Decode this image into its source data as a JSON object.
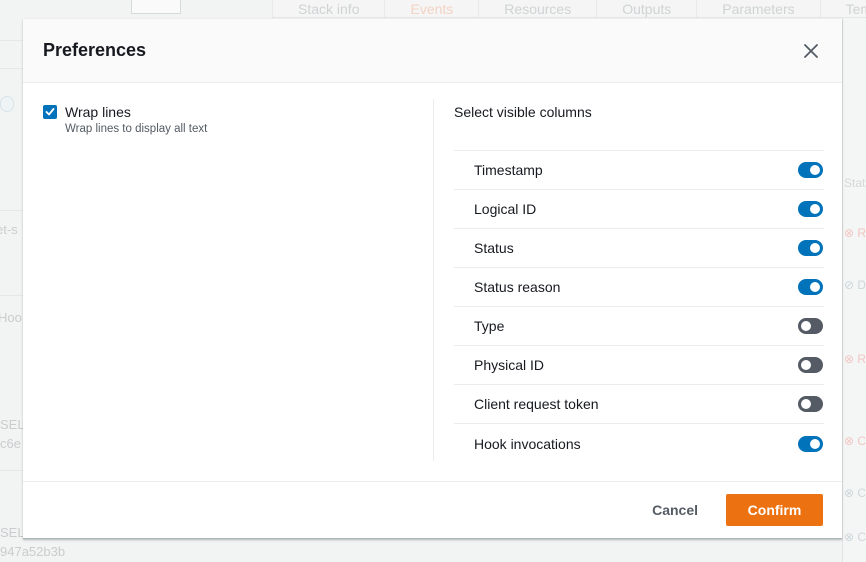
{
  "background": {
    "tabs": [
      {
        "label": "Stack info",
        "active": false
      },
      {
        "label": "Events",
        "active": true
      },
      {
        "label": "Resources",
        "active": false
      },
      {
        "label": "Outputs",
        "active": false
      },
      {
        "label": "Parameters",
        "active": false
      },
      {
        "label": "Template",
        "active": false
      }
    ],
    "left_fragments": [
      "et-s",
      "Hoo",
      "SEL",
      "c6e",
      "SEL",
      "947a52b3b"
    ],
    "right_fragments": [
      {
        "text": "Stat",
        "kind": "header"
      },
      {
        "text": "⊗ R",
        "kind": "failed"
      },
      {
        "text": "⊘ D",
        "kind": "ok"
      },
      {
        "text": "⊗ R",
        "kind": "failed"
      },
      {
        "text": "⊗ C",
        "kind": "failed"
      },
      {
        "text": "⊗ C",
        "kind": "ok"
      },
      {
        "text": "⊗ C",
        "kind": "ok"
      }
    ]
  },
  "modal": {
    "title": "Preferences",
    "close_icon": "close-icon",
    "wrap_lines": {
      "label": "Wrap lines",
      "description": "Wrap lines to display all text",
      "checked": true
    },
    "columns_section_title": "Select visible columns",
    "columns": [
      {
        "label": "Timestamp",
        "visible": true
      },
      {
        "label": "Logical ID",
        "visible": true
      },
      {
        "label": "Status",
        "visible": true
      },
      {
        "label": "Status reason",
        "visible": true
      },
      {
        "label": "Type",
        "visible": false
      },
      {
        "label": "Physical ID",
        "visible": false
      },
      {
        "label": "Client request token",
        "visible": false
      },
      {
        "label": "Hook invocations",
        "visible": true
      }
    ],
    "cancel_label": "Cancel",
    "confirm_label": "Confirm"
  },
  "colors": {
    "accent": "#0073bb",
    "primary_button": "#ec7211",
    "toggle_off": "#545b64"
  }
}
